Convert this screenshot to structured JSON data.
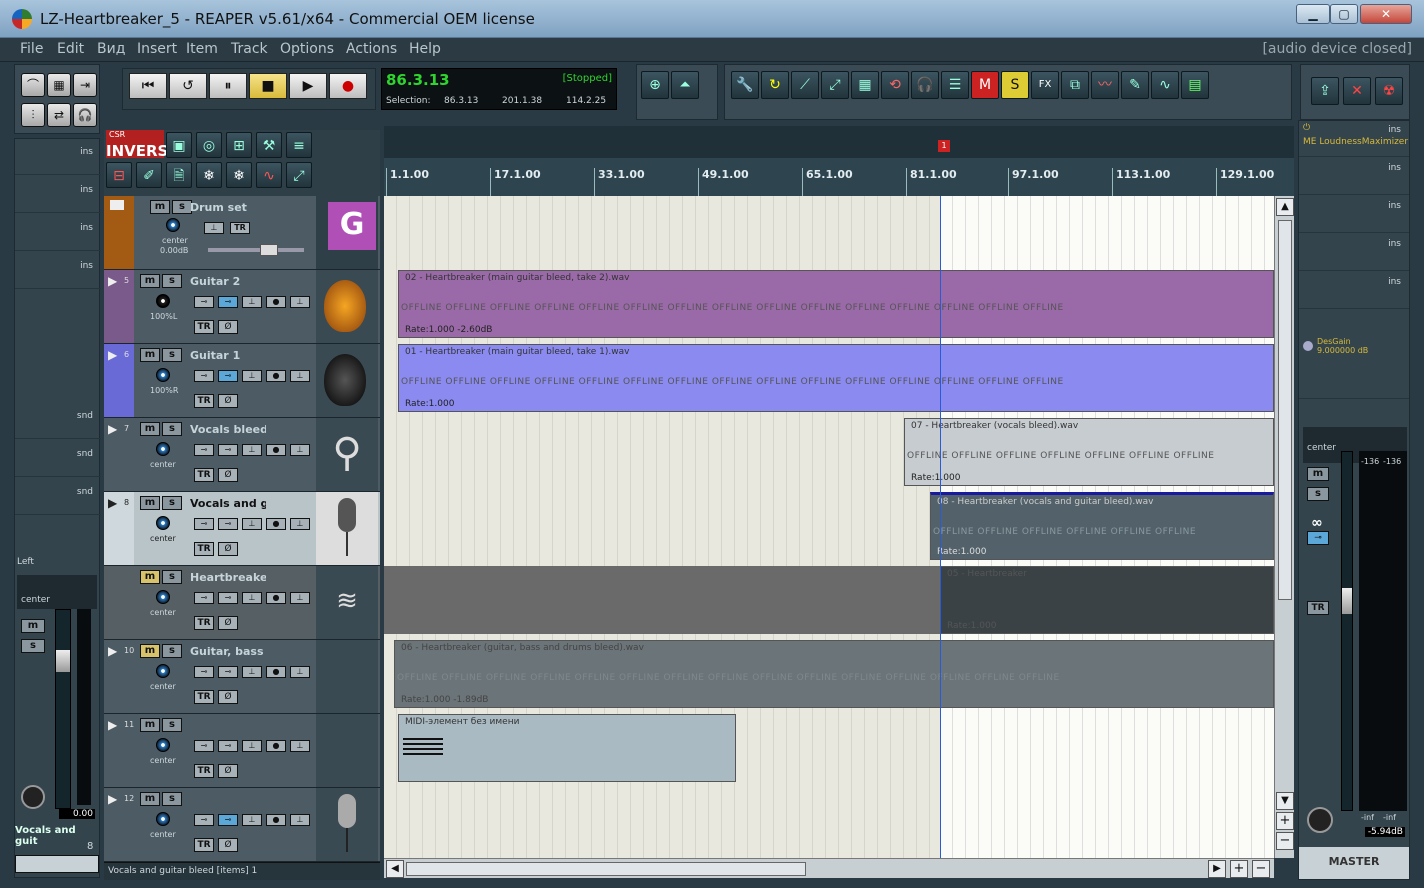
{
  "window": {
    "title": "LZ-Heartbreaker_5 - REAPER v5.61/x64 - Commercial OEM license",
    "minimize": "▁",
    "maximize": "▢",
    "close": "✕"
  },
  "menu": {
    "items": [
      "File",
      "Edit",
      "Вид",
      "Insert",
      "Item",
      "Track",
      "Options",
      "Actions",
      "Help"
    ],
    "device_status": "[audio device closed]"
  },
  "transport": {
    "time": "86.3.13",
    "state": "[Stopped]",
    "selection_label": "Selection:",
    "sel_start": "86.3.13",
    "sel_end": "201.1.38",
    "sel_length": "114.2.25",
    "buttons": [
      "⏮",
      "↺",
      "⏸",
      "■",
      "▶",
      "●"
    ]
  },
  "brand": {
    "small": "CSR",
    "label": "INVERSE"
  },
  "ruler": {
    "ticks": [
      "1.1.00",
      "17.1.00",
      "33.1.00",
      "49.1.00",
      "65.1.00",
      "81.1.00",
      "97.1.00",
      "113.1.00",
      "129.1.00"
    ],
    "marker": "1"
  },
  "tracks": [
    {
      "num": "",
      "name": "Drum set",
      "pan": "center",
      "vol": "0.00dB",
      "color": "#a35a12",
      "thumb": "G"
    },
    {
      "num": "5",
      "name": "Guitar 2",
      "pan": "100%L",
      "color": "#7a5a8a",
      "thumb": "guitar"
    },
    {
      "num": "6",
      "name": "Guitar 1",
      "pan": "100%R",
      "color": "#6a6ad6",
      "thumb": "guitar"
    },
    {
      "num": "7",
      "name": "Vocals bleed",
      "pan": "center",
      "color": "#4c5b64",
      "thumb": "person"
    },
    {
      "num": "8",
      "name": "Vocals and gu",
      "pan": "center",
      "color": "#cfd8dc",
      "thumb": "mic"
    },
    {
      "num": "",
      "name": "Heartbreaker",
      "pan": "center",
      "color": "#4c5b64",
      "thumb": "wave"
    },
    {
      "num": "10",
      "name": "Guitar, bass a",
      "pan": "center",
      "color": "#4c5b64",
      "thumb": ""
    },
    {
      "num": "11",
      "name": "",
      "pan": "center",
      "color": "#4c5b64",
      "thumb": ""
    },
    {
      "num": "12",
      "name": "",
      "pan": "center",
      "color": "#4c5b64",
      "thumb": "mic"
    }
  ],
  "items": [
    {
      "name": "02 - Heartbreaker (main guitar bleed, take 2).wav",
      "rate": "Rate:1.000 -2.60dB"
    },
    {
      "name": "01 - Heartbreaker (main guitar bleed, take 1).wav",
      "rate": "Rate:1.000"
    },
    {
      "name": "07 - Heartbreaker (vocals bleed).wav",
      "rate": "Rate:1.000"
    },
    {
      "name": "08 - Heartbreaker (vocals and guitar bleed).wav",
      "rate": "Rate:1.000"
    },
    {
      "name": "05 - Heartbreaker",
      "rate": "Rate:1.000"
    },
    {
      "name": "06 - Heartbreaker (guitar, bass and drums bleed).wav",
      "rate": "Rate:1.000 -1.89dB"
    },
    {
      "name": "MIDI-элемент без имени",
      "rate": ""
    }
  ],
  "offline": "OFFLINE",
  "left_mixer": {
    "ins": "ins",
    "snd": "snd",
    "left_label": "Left",
    "pan": "center",
    "vol": "0.00",
    "track_name": "Vocals and guit",
    "track_num": "8",
    "m": "m",
    "s": "s"
  },
  "master": {
    "plugin1": "ME LoudnessMaximizer",
    "plugin2": "DesGain",
    "plugin2_val": "9.000000 dB",
    "pan": "center",
    "meter_l": "-136",
    "meter_r": "-136",
    "inf_l": "-inf",
    "inf_r": "-inf",
    "vol": "-5.94dB",
    "label": "MASTER",
    "ins": "ins"
  },
  "status": {
    "text": "Vocals and guitar bleed [items] 1"
  }
}
